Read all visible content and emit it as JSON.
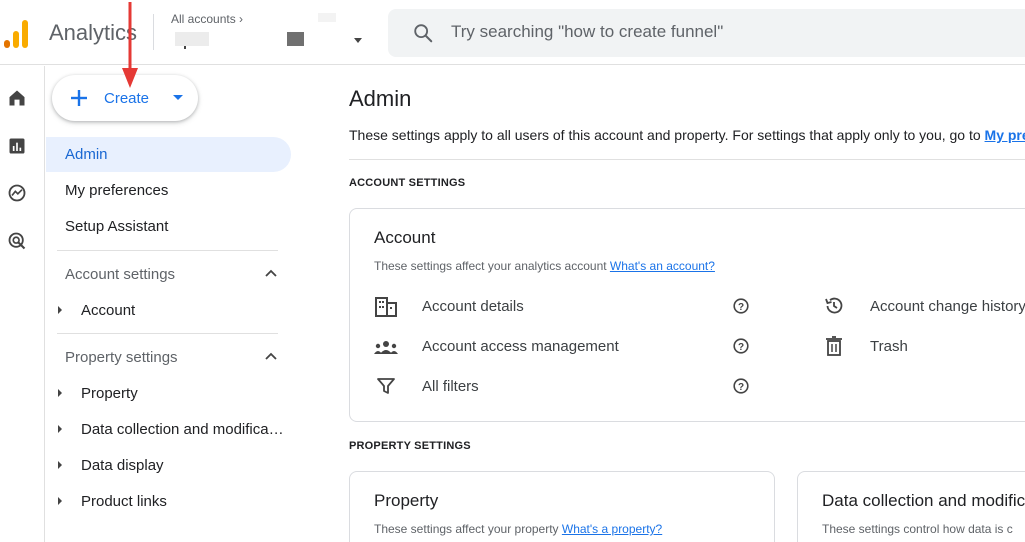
{
  "header": {
    "app_name": "Analytics",
    "accounts_crumb": "All accounts",
    "search_placeholder": "Try searching \"how to create funnel\""
  },
  "create_button": {
    "label": "Create"
  },
  "sidebar": {
    "items": [
      {
        "label": "Admin",
        "active": true
      },
      {
        "label": "My preferences"
      },
      {
        "label": "Setup Assistant"
      }
    ],
    "account_settings": {
      "heading": "Account settings",
      "items": [
        "Account"
      ]
    },
    "property_settings": {
      "heading": "Property settings",
      "items": [
        "Property",
        "Data collection and modifica…",
        "Data display",
        "Product links"
      ]
    }
  },
  "main": {
    "title": "Admin",
    "description": "These settings apply to all users of this account and property. For settings that apply only to you, go to ",
    "description_link": "My pre",
    "account_section_label": "ACCOUNT SETTINGS",
    "property_section_label": "PROPERTY SETTINGS",
    "account_card": {
      "title": "Account",
      "desc": "These settings affect your analytics account ",
      "link": "What's an account?",
      "rows": {
        "details": "Account details",
        "access": "Account access management",
        "filters": "All filters",
        "history": "Account change history",
        "trash": "Trash"
      }
    },
    "property_card": {
      "title": "Property",
      "desc": "These settings affect your property ",
      "link": "What's a property?"
    },
    "data_card": {
      "title": "Data collection and modifica",
      "desc": "These settings control how data is c"
    }
  },
  "colors": {
    "accent": "#1a73e8",
    "active_bg": "#e8f0fe",
    "annotation_arrow": "#e53935"
  }
}
